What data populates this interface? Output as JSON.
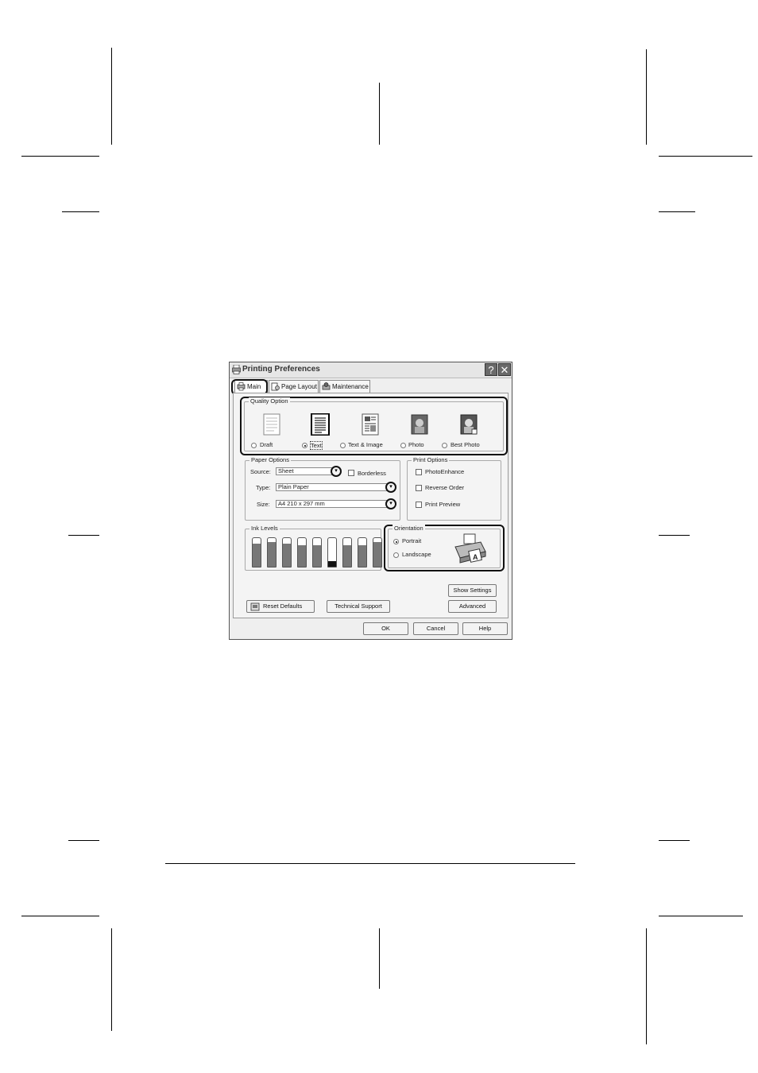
{
  "dialog": {
    "title": "Printing Preferences",
    "help_label": "?",
    "close_label": "✕",
    "tabs": [
      {
        "label": "Main",
        "icon": "printer-icon",
        "selected": true
      },
      {
        "label": "Page Layout",
        "icon": "page-layout-icon",
        "selected": false
      },
      {
        "label": "Maintenance",
        "icon": "maintenance-icon",
        "selected": false
      }
    ]
  },
  "quality": {
    "group_label": "Quality Option",
    "options": [
      {
        "label": "Draft",
        "icon": "draft-page-icon",
        "selected": false
      },
      {
        "label": "Text",
        "icon": "text-page-icon",
        "selected": true
      },
      {
        "label": "Text & Image",
        "icon": "text-image-page-icon",
        "selected": false
      },
      {
        "label": "Photo",
        "icon": "photo-icon",
        "selected": false
      },
      {
        "label": "Best Photo",
        "icon": "best-photo-icon",
        "selected": false
      }
    ]
  },
  "paper": {
    "group_label": "Paper Options",
    "source_label": "Source:",
    "source_value": "Sheet",
    "borderless_label": "Borderless",
    "type_label": "Type:",
    "type_value": "Plain Paper",
    "size_label": "Size:",
    "size_value": "A4 210 x 297 mm"
  },
  "print_options": {
    "group_label": "Print Options",
    "items": [
      {
        "label": "PhotoEnhance",
        "checked": false
      },
      {
        "label": "Reverse Order",
        "checked": false
      },
      {
        "label": "Print Preview",
        "checked": false
      }
    ]
  },
  "ink": {
    "group_label": "Ink Levels",
    "levels": [
      0.8,
      0.85,
      0.8,
      0.75,
      0.75,
      0.2,
      0.75,
      0.75,
      0.85
    ]
  },
  "orientation": {
    "group_label": "Orientation",
    "portrait_label": "Portrait",
    "landscape_label": "Landscape",
    "selected": "Portrait"
  },
  "buttons": {
    "show_settings": "Show Settings",
    "advanced": "Advanced",
    "reset_defaults": "Reset Defaults",
    "technical_support": "Technical Support",
    "ok": "OK",
    "cancel": "Cancel",
    "help": "Help"
  }
}
